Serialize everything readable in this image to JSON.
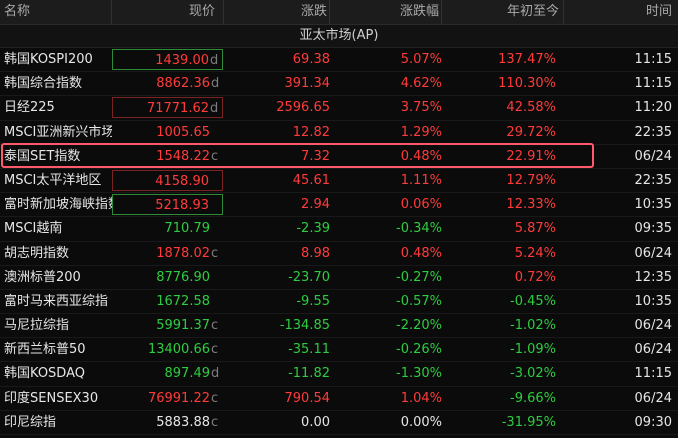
{
  "header": {
    "name": "名称",
    "price": "现价",
    "change": "涨跌",
    "change_pct": "涨跌幅",
    "ytd": "年初至今",
    "time": "时间"
  },
  "section_title": "亚太市场(AP)",
  "colors": {
    "up": "#ff3b3b",
    "down": "#2ecc40",
    "highlight": "#ff5a6a"
  },
  "rows": [
    {
      "name": "韩国KOSPI200",
      "price": "1439.00",
      "suffix": "d",
      "change": "69.38",
      "change_pct": "5.07%",
      "ytd": "137.47%",
      "time": "11:15",
      "dir": "up",
      "ytd_dir": "up",
      "box": "green"
    },
    {
      "name": "韩国综合指数",
      "price": "8862.36",
      "suffix": "d",
      "change": "391.34",
      "change_pct": "4.62%",
      "ytd": "110.30%",
      "time": "11:15",
      "dir": "up",
      "ytd_dir": "up",
      "box": ""
    },
    {
      "name": "日经225",
      "price": "71771.62",
      "suffix": "d",
      "change": "2596.65",
      "change_pct": "3.75%",
      "ytd": "42.58%",
      "time": "11:20",
      "dir": "up",
      "ytd_dir": "up",
      "box": "red"
    },
    {
      "name": "MSCI亚洲新兴市场",
      "price": "1005.65",
      "suffix": "",
      "change": "12.82",
      "change_pct": "1.29%",
      "ytd": "29.72%",
      "time": "22:35",
      "dir": "up",
      "ytd_dir": "up",
      "box": ""
    },
    {
      "name": "泰国SET指数",
      "price": "1548.22",
      "suffix": "c",
      "change": "7.32",
      "change_pct": "0.48%",
      "ytd": "22.91%",
      "time": "06/24",
      "dir": "up",
      "ytd_dir": "up",
      "box": ""
    },
    {
      "name": "MSCI太平洋地区",
      "price": "4158.90",
      "suffix": "",
      "change": "45.61",
      "change_pct": "1.11%",
      "ytd": "12.79%",
      "time": "22:35",
      "dir": "up",
      "ytd_dir": "up",
      "box": "red"
    },
    {
      "name": "富时新加坡海峡指数",
      "price": "5218.93",
      "suffix": "",
      "change": "2.94",
      "change_pct": "0.06%",
      "ytd": "12.33%",
      "time": "10:35",
      "dir": "up",
      "ytd_dir": "up",
      "box": "green"
    },
    {
      "name": "MSCI越南",
      "price": "710.79",
      "suffix": "",
      "change": "-2.39",
      "change_pct": "-0.34%",
      "ytd": "5.87%",
      "time": "09:35",
      "dir": "down",
      "ytd_dir": "up",
      "box": ""
    },
    {
      "name": "胡志明指数",
      "price": "1878.02",
      "suffix": "c",
      "change": "8.98",
      "change_pct": "0.48%",
      "ytd": "5.24%",
      "time": "06/24",
      "dir": "up",
      "ytd_dir": "up",
      "box": ""
    },
    {
      "name": "澳洲标普200",
      "price": "8776.90",
      "suffix": "",
      "change": "-23.70",
      "change_pct": "-0.27%",
      "ytd": "0.72%",
      "time": "12:35",
      "dir": "down",
      "ytd_dir": "up",
      "box": ""
    },
    {
      "name": "富时马来西亚综指",
      "price": "1672.58",
      "suffix": "",
      "change": "-9.55",
      "change_pct": "-0.57%",
      "ytd": "-0.45%",
      "time": "10:35",
      "dir": "down",
      "ytd_dir": "down",
      "box": ""
    },
    {
      "name": "马尼拉综指",
      "price": "5991.37",
      "suffix": "c",
      "change": "-134.85",
      "change_pct": "-2.20%",
      "ytd": "-1.02%",
      "time": "06/24",
      "dir": "down",
      "ytd_dir": "down",
      "box": ""
    },
    {
      "name": "新西兰标普50",
      "price": "13400.66",
      "suffix": "c",
      "change": "-35.11",
      "change_pct": "-0.26%",
      "ytd": "-1.09%",
      "time": "06/24",
      "dir": "down",
      "ytd_dir": "down",
      "box": ""
    },
    {
      "name": "韩国KOSDAQ",
      "price": "897.49",
      "suffix": "d",
      "change": "-11.82",
      "change_pct": "-1.30%",
      "ytd": "-3.02%",
      "time": "11:15",
      "dir": "down",
      "ytd_dir": "down",
      "box": ""
    },
    {
      "name": "印度SENSEX30",
      "price": "76991.22",
      "suffix": "c",
      "change": "790.54",
      "change_pct": "1.04%",
      "ytd": "-9.66%",
      "time": "06/24",
      "dir": "up",
      "ytd_dir": "down",
      "box": ""
    },
    {
      "name": "印尼综指",
      "price": "5883.88",
      "suffix": "c",
      "change": "0.00",
      "change_pct": "0.00%",
      "ytd": "-31.95%",
      "time": "09:30",
      "dir": "flat",
      "ytd_dir": "down",
      "box": ""
    }
  ]
}
